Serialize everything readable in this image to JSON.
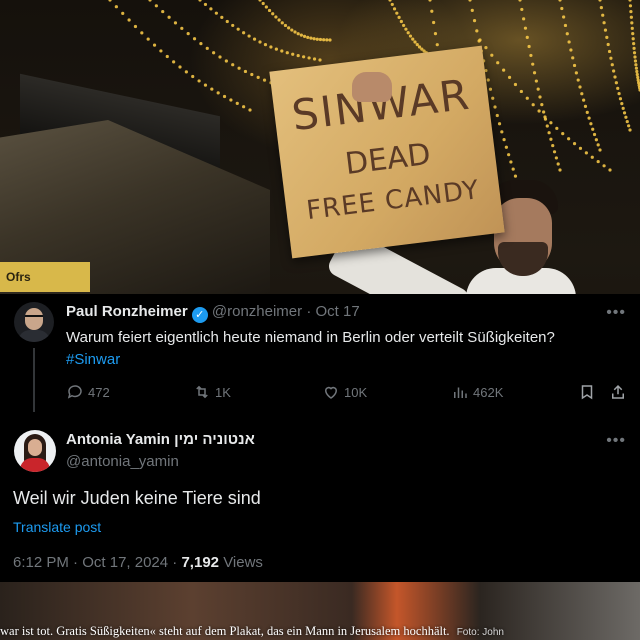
{
  "photo": {
    "shop_sign": "Ofrs",
    "sign_text": [
      "SINWAR",
      "DEAD",
      "FREE CANDY"
    ]
  },
  "tweet": {
    "author": {
      "name": "Paul Ronzheimer",
      "handle": "@ronzheimer",
      "date": "Oct 17"
    },
    "text": "Warum feiert eigentlich heute niemand in Berlin oder verteilt Süßigkeiten?",
    "hashtag": "#Sinwar",
    "stats": {
      "replies": "472",
      "reposts": "1K",
      "likes": "10K",
      "views": "462K"
    }
  },
  "reply": {
    "name": "Antonia Yamin",
    "name_hebrew": "אנטוניה ימין",
    "handle": "@antonia_yamin",
    "text": "Weil wir Juden keine Tiere sind",
    "translate_label": "Translate post",
    "time": "6:12 PM",
    "date": "Oct 17, 2024",
    "views_count": "7,192",
    "views_label": "Views"
  },
  "caption": {
    "text": "war ist tot. Gratis Süßigkeiten« steht auf dem Plakat, das ein Mann in Jerusalem hochhält.",
    "credit": "Foto: John"
  },
  "colors": {
    "accent": "#1d9bf0",
    "muted": "#71767b",
    "text": "#e7e9ea",
    "card_bg": "#000000"
  },
  "icons": [
    "verified-badge-icon",
    "more-icon",
    "reply-icon",
    "repost-icon",
    "like-icon",
    "views-icon",
    "bookmark-icon",
    "share-icon"
  ]
}
